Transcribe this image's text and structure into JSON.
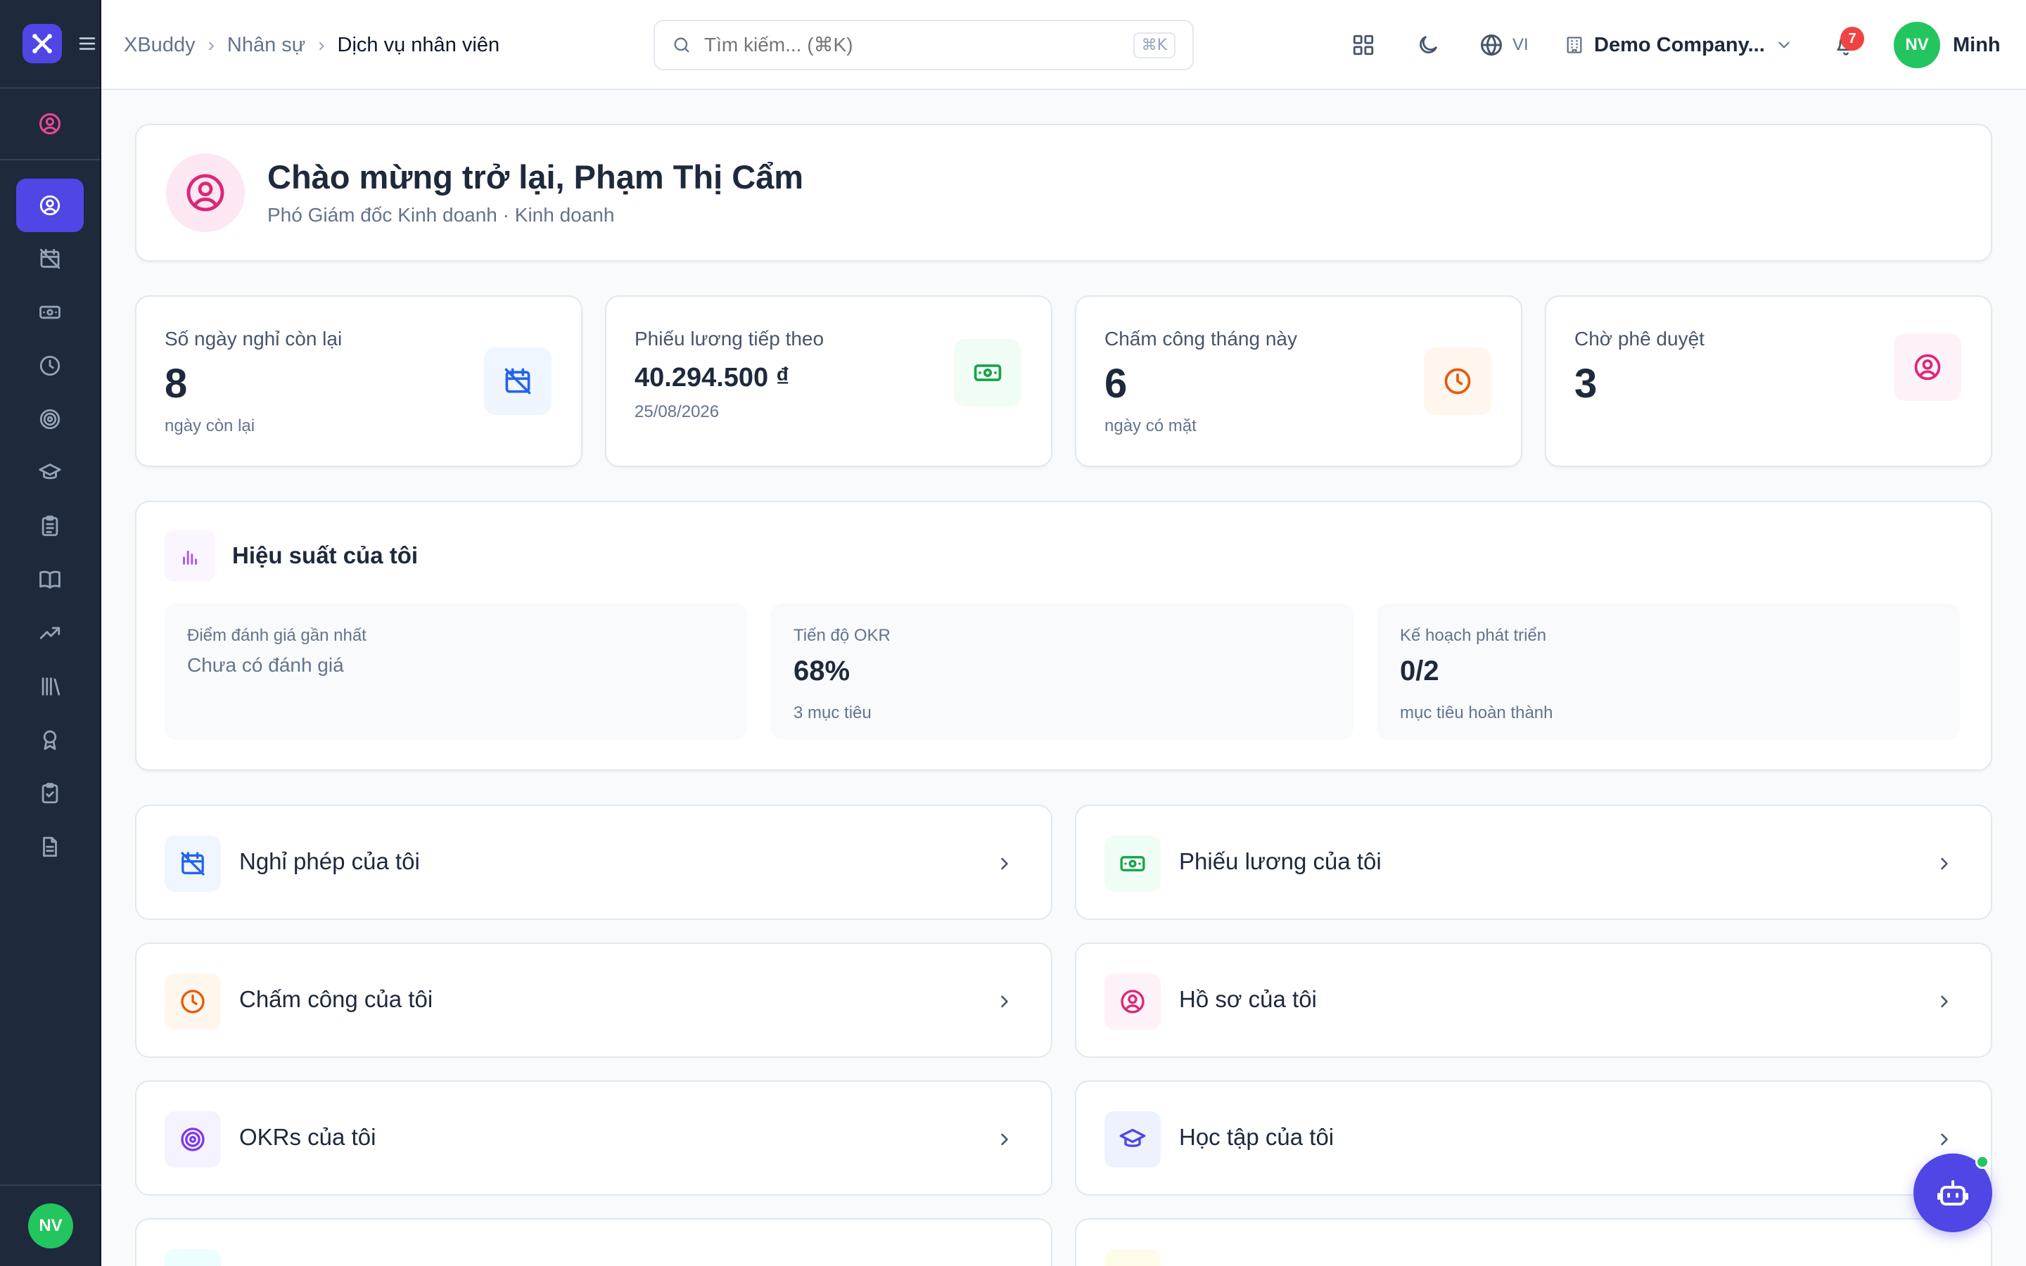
{
  "sidebar": {
    "user_initials": "NV",
    "items": [
      {
        "icon": "user-circle-icon",
        "active": true
      },
      {
        "icon": "calendar-off-icon"
      },
      {
        "icon": "banknote-icon"
      },
      {
        "icon": "clock-icon"
      },
      {
        "icon": "target-icon"
      },
      {
        "icon": "graduation-cap-icon"
      },
      {
        "icon": "clipboard-list-icon"
      },
      {
        "icon": "book-open-icon"
      },
      {
        "icon": "trending-up-icon"
      },
      {
        "icon": "library-icon"
      },
      {
        "icon": "award-icon"
      },
      {
        "icon": "clipboard-check-icon"
      },
      {
        "icon": "file-text-icon"
      }
    ]
  },
  "header": {
    "breadcrumb": [
      "XBuddy",
      "Nhân sự",
      "Dịch vụ nhân viên"
    ],
    "search_placeholder": "Tìm kiếm... (⌘K)",
    "search_shortcut": "⌘K",
    "language": "VI",
    "company": "Demo Company...",
    "notification_count": "7",
    "user_initials": "NV",
    "user_name": "Minh"
  },
  "welcome": {
    "title": "Chào mừng trở lại, Phạm Thị Cẩm",
    "subtitle": "Phó Giám đốc Kinh doanh · Kinh doanh"
  },
  "stats": [
    {
      "label": "Số ngày nghỉ còn lại",
      "value": "8",
      "sub": "ngày còn lại",
      "icon": "calendar-off-icon",
      "color": "#2563eb",
      "bg": "#eff6ff"
    },
    {
      "label": "Phiếu lương tiếp theo",
      "value": "40.294.500 ₫",
      "sub": "25/08/2026",
      "icon": "banknote-icon",
      "color": "#16a34a",
      "bg": "#f0fdf4"
    },
    {
      "label": "Chấm công tháng này",
      "value": "6",
      "sub": "ngày có mặt",
      "icon": "clock-icon",
      "color": "#ea580c",
      "bg": "#fff7ed"
    },
    {
      "label": "Chờ phê duyệt",
      "value": "3",
      "sub": "",
      "icon": "user-circle-icon",
      "color": "#db2777",
      "bg": "#fdf2f8"
    }
  ],
  "performance": {
    "title": "Hiệu suất của tôi",
    "boxes": [
      {
        "label": "Điểm đánh giá gần nhất",
        "value": "Chưa có đánh giá",
        "sub": ""
      },
      {
        "label": "Tiến độ OKR",
        "value": "68%",
        "sub": "3 mục tiêu"
      },
      {
        "label": "Kế hoạch phát triển",
        "value": "0/2",
        "sub": "mục tiêu hoàn thành"
      }
    ]
  },
  "links": [
    {
      "label": "Nghỉ phép của tôi",
      "icon": "calendar-off-icon",
      "color": "#2563eb",
      "bg": "#eff6ff"
    },
    {
      "label": "Phiếu lương của tôi",
      "icon": "banknote-icon",
      "color": "#16a34a",
      "bg": "#f0fdf4"
    },
    {
      "label": "Chấm công của tôi",
      "icon": "clock-icon",
      "color": "#ea580c",
      "bg": "#fff7ed"
    },
    {
      "label": "Hồ sơ của tôi",
      "icon": "user-circle-icon",
      "color": "#db2777",
      "bg": "#fdf2f8"
    },
    {
      "label": "OKRs của tôi",
      "icon": "target-icon",
      "color": "#7c3aed",
      "bg": "#f5f3ff"
    },
    {
      "label": "Học tập của tôi",
      "icon": "graduation-cap-icon",
      "color": "#4f46e5",
      "bg": "#eef2ff"
    }
  ],
  "colors": {
    "accent": "#4f46e5",
    "sidebar": "#1e293b",
    "online": "#22c55e",
    "alert": "#ef4444"
  }
}
